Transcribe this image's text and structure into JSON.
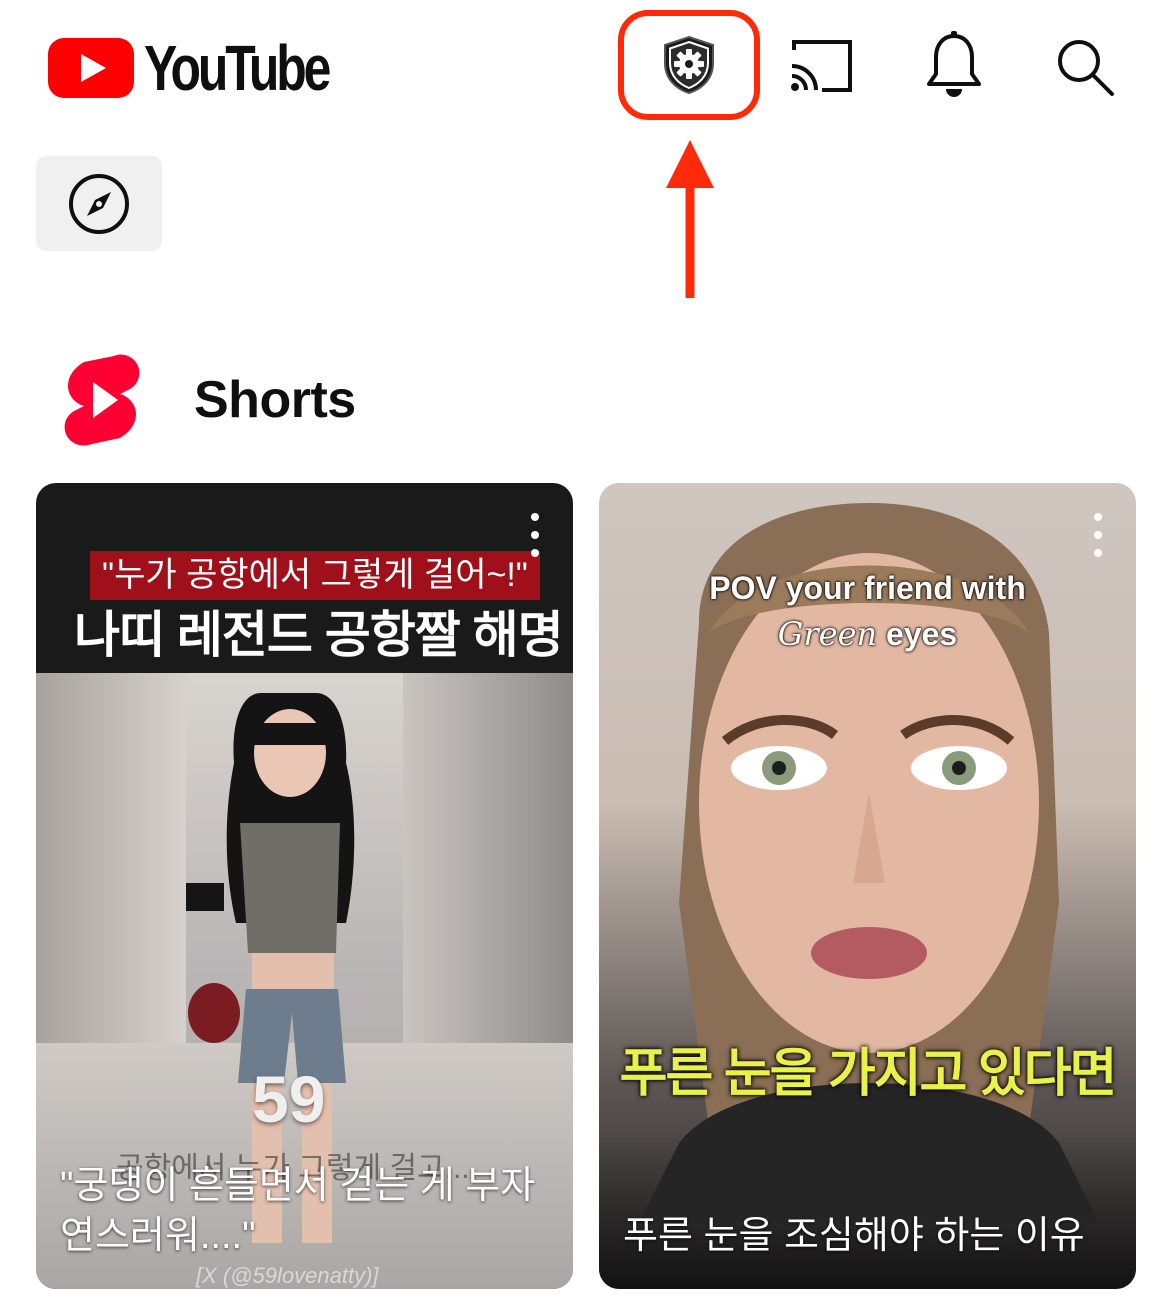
{
  "header": {
    "app_name": "YouTube",
    "icons": [
      "youtube-logo-icon",
      "shield-gear-icon",
      "cast-icon",
      "bell-icon",
      "search-icon"
    ],
    "brand_color": "#ff0000",
    "highlight_color": "#ff2a0a"
  },
  "chips": [
    {
      "icon": "compass-icon"
    }
  ],
  "shorts": {
    "title": "Shorts",
    "items": [
      {
        "overlay_tag": "\"누가 공항에서 그렇게 걸어~!\"",
        "overlay_headline": "나띠 레전드 공항짤 해명",
        "overlay_number": "59",
        "overlay_subtitle": "공항에서 누가 그렇게 걸고...",
        "overlay_credit": "[X (@59lovenatty)]",
        "title": "\"궁댕이 흔들면서 걷는 게 부자연스러워....\""
      },
      {
        "overlay_line1": "POV your friend with",
        "overlay_green": "Green",
        "overlay_eyes": "eyes",
        "overlay_caption": "푸른 눈을 가지고 있다면",
        "title": "푸른 눈을 조심해야 하는 이유"
      }
    ]
  }
}
